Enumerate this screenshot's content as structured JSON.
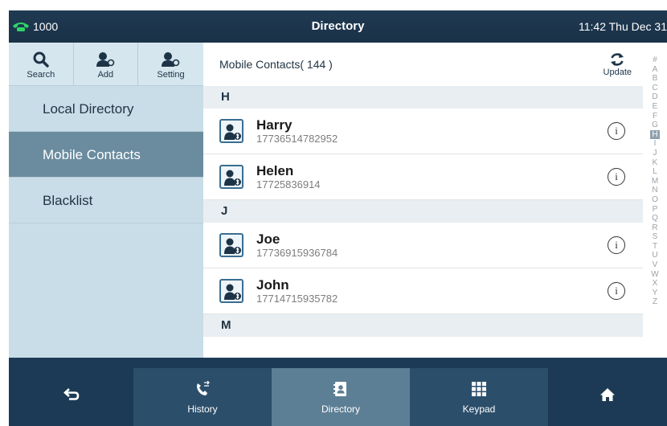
{
  "status": {
    "line_number": "1000",
    "title": "Directory",
    "datetime": "11:42 Thu Dec 31"
  },
  "toolbar": [
    {
      "label": "Search",
      "icon": "search-icon"
    },
    {
      "label": "Add",
      "icon": "add-contact-icon"
    },
    {
      "label": "Setting",
      "icon": "contact-setting-icon"
    }
  ],
  "nav": [
    {
      "label": "Local Directory",
      "active": false
    },
    {
      "label": "Mobile Contacts",
      "active": true
    },
    {
      "label": "Blacklist",
      "active": false
    }
  ],
  "content": {
    "header": "Mobile Contacts( 144 )",
    "update_label": "Update",
    "sections": [
      {
        "letter": "H",
        "contacts": [
          {
            "name": "Harry",
            "number": "17736514782952"
          },
          {
            "name": "Helen",
            "number": "17725836914"
          }
        ]
      },
      {
        "letter": "J",
        "contacts": [
          {
            "name": "Joe",
            "number": "17736915936784"
          },
          {
            "name": "John",
            "number": "17714715935782"
          }
        ]
      },
      {
        "letter": "M",
        "contacts": []
      }
    ]
  },
  "alphabet": [
    "#",
    "A",
    "B",
    "C",
    "D",
    "E",
    "F",
    "G",
    "H",
    "I",
    "J",
    "K",
    "L",
    "M",
    "N",
    "O",
    "P",
    "Q",
    "R",
    "S",
    "T",
    "U",
    "V",
    "W",
    "X",
    "Y",
    "Z"
  ],
  "alphabet_selected": "H",
  "bottom": {
    "history": "History",
    "directory": "Directory",
    "keypad": "Keypad"
  },
  "colors": {
    "status_bg": "#1f3a52",
    "nav_active": "#6b8c9f",
    "left_panel": "#c8dde7",
    "bottom_selected": "#5d7f95",
    "phone_icon": "#2fd46b"
  }
}
